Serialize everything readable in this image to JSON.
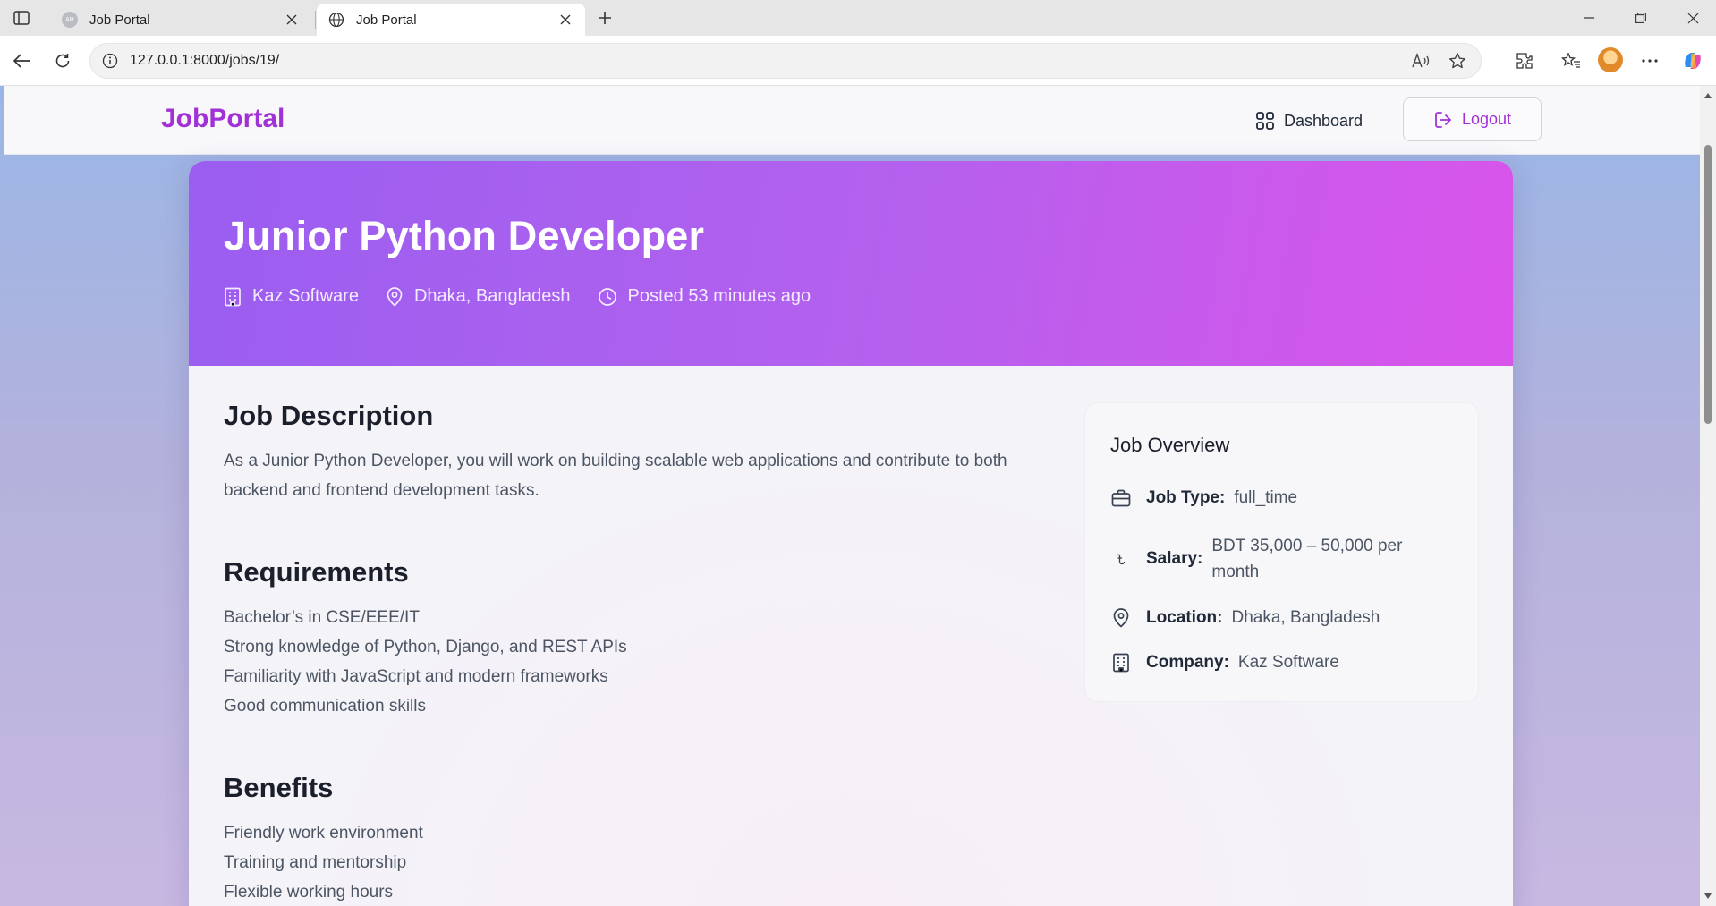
{
  "browser": {
    "tabs": [
      {
        "title": "Job Portal",
        "favicon_text": "AR",
        "active": false
      },
      {
        "title": "Job Portal",
        "active": true
      }
    ],
    "url": "127.0.0.1:8000/jobs/19/"
  },
  "nav": {
    "brand": "JobPortal",
    "dashboard_label": "Dashboard",
    "logout_label": "Logout"
  },
  "job": {
    "title": "Junior Python Developer",
    "company": "Kaz Software",
    "location": "Dhaka, Bangladesh",
    "posted": "Posted 53 minutes ago",
    "description_heading": "Job Description",
    "description": "As a Junior Python Developer, you will work on building scalable web applications and contribute to both backend and frontend development tasks.",
    "requirements_heading": "Requirements",
    "requirements": [
      "Bachelor’s in CSE/EEE/IT",
      "Strong knowledge of Python, Django, and REST APIs",
      "Familiarity with JavaScript and modern frameworks",
      "Good communication skills"
    ],
    "benefits_heading": "Benefits",
    "benefits": [
      "Friendly work environment",
      "Training and mentorship",
      "Flexible working hours"
    ]
  },
  "overview": {
    "title": "Job Overview",
    "job_type_label": "Job Type:",
    "job_type": "full_time",
    "salary_label": "Salary:",
    "salary": "BDT 35,000 – 50,000 per month",
    "location_label": "Location:",
    "location": "Dhaka, Bangladesh",
    "company_label": "Company:",
    "company": "Kaz Software"
  },
  "colors": {
    "brand": "#a131d6",
    "hero_start": "#9a5ef0",
    "hero_end": "#d954ea"
  }
}
